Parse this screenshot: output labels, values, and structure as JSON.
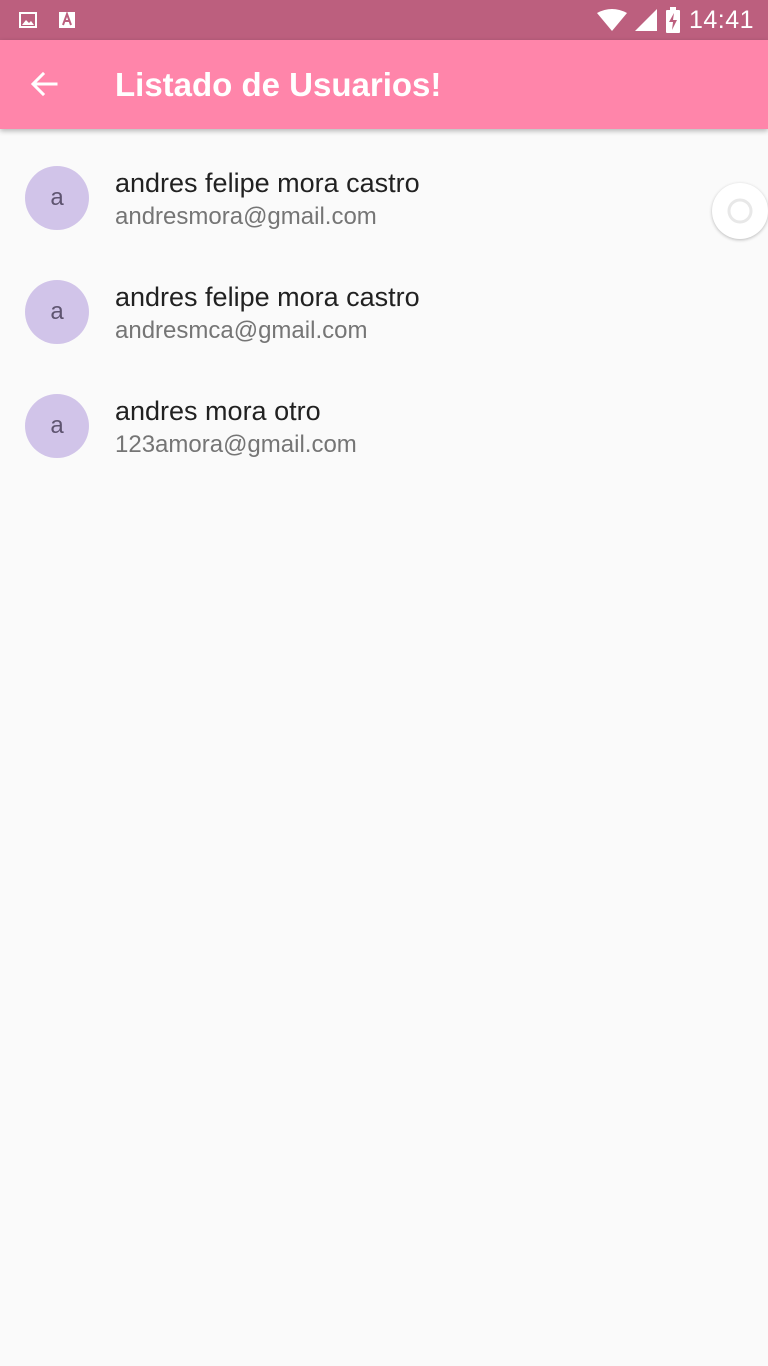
{
  "status_bar": {
    "time": "14:41",
    "left_icons": [
      "image-icon",
      "font-icon"
    ],
    "right_icons": [
      "wifi-icon",
      "signal-icon",
      "battery-charging-icon"
    ],
    "background_color": "#bc5f7e"
  },
  "app_bar": {
    "title": "Listado de Usuarios!",
    "back_icon": "arrow-back-icon",
    "background_color": "#ff85aa"
  },
  "users": [
    {
      "avatar_letter": "a",
      "name": "andres felipe mora castro",
      "email": "andresmora@gmail.com"
    },
    {
      "avatar_letter": "a",
      "name": "andres felipe mora castro",
      "email": "andresmca@gmail.com"
    },
    {
      "avatar_letter": "a",
      "name": "andres mora otro",
      "email": "123amora@gmail.com"
    }
  ],
  "colors": {
    "avatar_bg": "#d1c4e9",
    "background": "#fafafa"
  }
}
